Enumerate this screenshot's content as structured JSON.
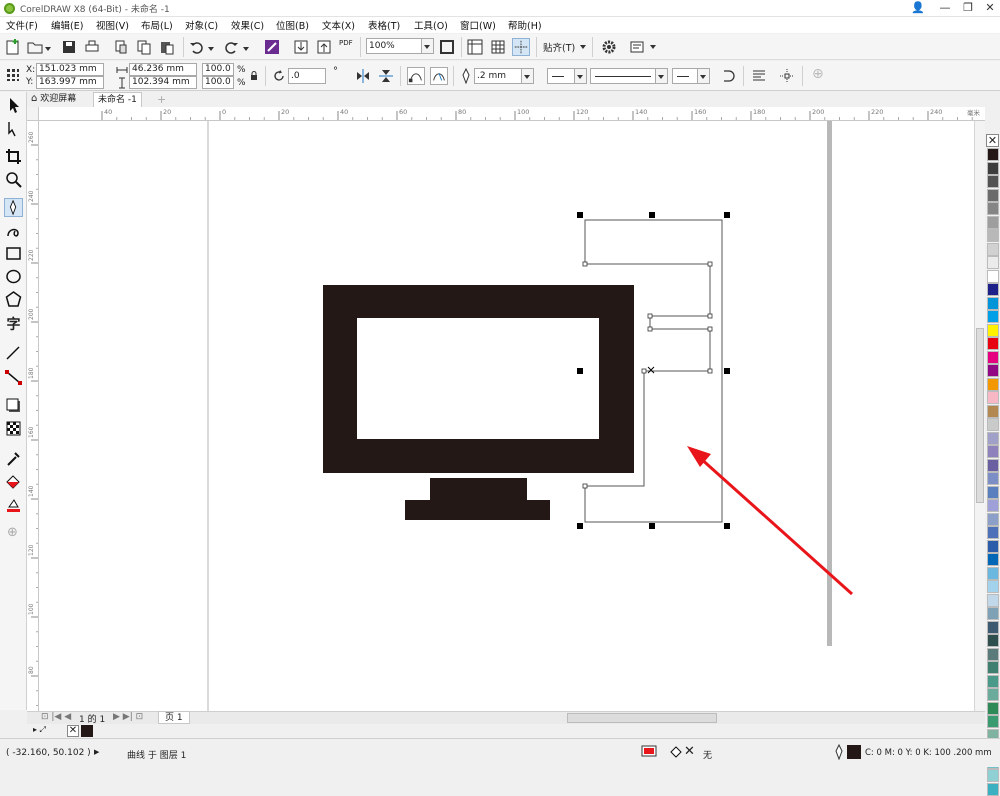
{
  "window": {
    "title": "CorelDRAW X8 (64-Bit) - 未命名 -1",
    "controls": [
      "—",
      "❐",
      "✕"
    ]
  },
  "menu": [
    "文件(F)",
    "编辑(E)",
    "视图(V)",
    "布局(L)",
    "对象(C)",
    "效果(C)",
    "位图(B)",
    "文本(X)",
    "表格(T)",
    "工具(O)",
    "窗口(W)",
    "帮助(H)"
  ],
  "toolbar1": {
    "zoom_value": "100%",
    "snap_label": "贴齐(T)",
    "pdf_label": "PDF"
  },
  "propbar": {
    "x_label": "X:",
    "x_value": "151.023 mm",
    "y_label": "Y:",
    "y_value": "163.997 mm",
    "width_value": "46.236 mm",
    "height_value": "102.394 mm",
    "scale_x": "100.0",
    "scale_y": "100.0",
    "percent": "%",
    "rotation_value": ".0",
    "outline_width": ".2 mm"
  },
  "doctabs": {
    "welcome": "欢迎屏幕",
    "document": "未命名 -1"
  },
  "ruler": {
    "h_ticks": [
      "40",
      "20",
      "0",
      "20",
      "40",
      "60",
      "80",
      "100",
      "120",
      "140",
      "160",
      "180",
      "200",
      "220",
      "240"
    ],
    "v_ticks": [
      "260",
      "240",
      "220",
      "200",
      "180",
      "160",
      "140",
      "120",
      "100",
      "80",
      "60",
      "40"
    ],
    "unit": "毫米"
  },
  "palette": {
    "colors": [
      "#231815",
      "#3d3d3d",
      "#525252",
      "#6b6b6b",
      "#858585",
      "#9e9e9e",
      "#b8b8b8",
      "#d1d1d1",
      "#ebebeb",
      "#ffffff",
      "#1d2088",
      "#0095d9",
      "#00a0e9",
      "#fff100",
      "#e60012",
      "#e4007f",
      "#920783",
      "#f39800",
      "#f7b7c4",
      "#b28850",
      "#c9caca",
      "#a0a0c8",
      "#8f82bc",
      "#6a5fa0",
      "#7b8fc6",
      "#5a7fbf",
      "#9fa0d7",
      "#8c9fc9",
      "#4d70b8",
      "#2a5caa",
      "#0068b7",
      "#6ab8e0",
      "#a3d2ec",
      "#c0d8ea",
      "#7fa1b6",
      "#3e5a70",
      "#2f4f4f",
      "#5b7a7a",
      "#3f7f6f",
      "#4a9a8a",
      "#6bab9b",
      "#2e8b57",
      "#3a9a70",
      "#7fb3a0",
      "#5e9fa5",
      "#6ec1c8",
      "#8fd0d5",
      "#3ab0c0"
    ]
  },
  "pagebar": {
    "page_count": "1 的 1",
    "page_tab": "页 1"
  },
  "status": {
    "coords": "( -32.160, 50.102 )",
    "object_info": "曲线 于 图层 1",
    "fill_none": "无",
    "outline_info": "C: 0 M: 0 Y: 0 K: 100  .200 mm"
  },
  "colors": {
    "monitor_fill": "#231815",
    "arrow": "#e8161b",
    "selection_handle": "#000000"
  }
}
